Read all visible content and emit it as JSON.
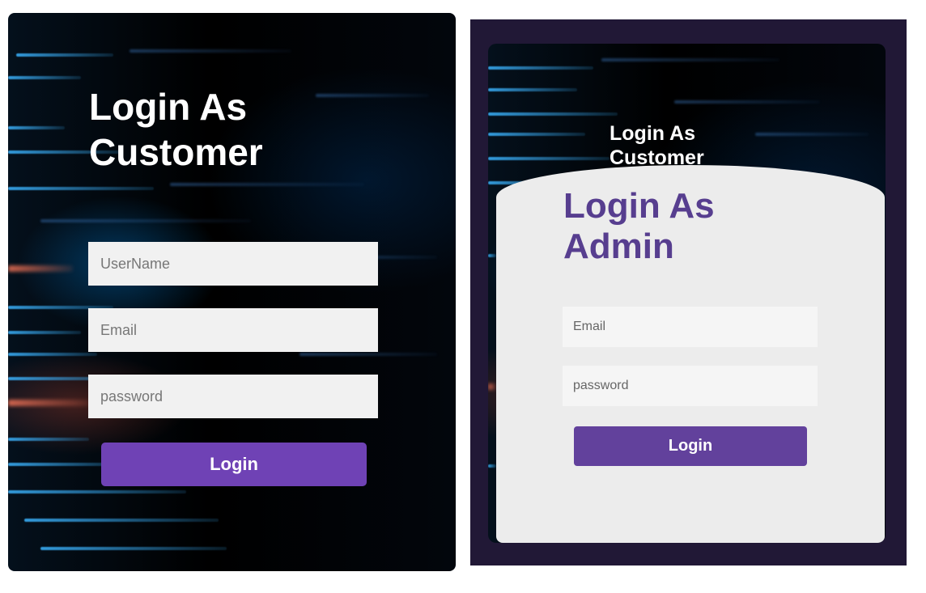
{
  "customer_panel": {
    "title": "Login As Customer",
    "username_placeholder": "UserName",
    "email_placeholder": "Email",
    "password_placeholder": "password",
    "login_label": "Login",
    "accent_color": "#6f42b5"
  },
  "admin_panel": {
    "background_title": "Login As Customer",
    "title": "Login As Admin",
    "email_placeholder": "Email",
    "password_placeholder": "password",
    "login_label": "Login",
    "accent_color": "#62419c",
    "card_color": "#ececec"
  }
}
